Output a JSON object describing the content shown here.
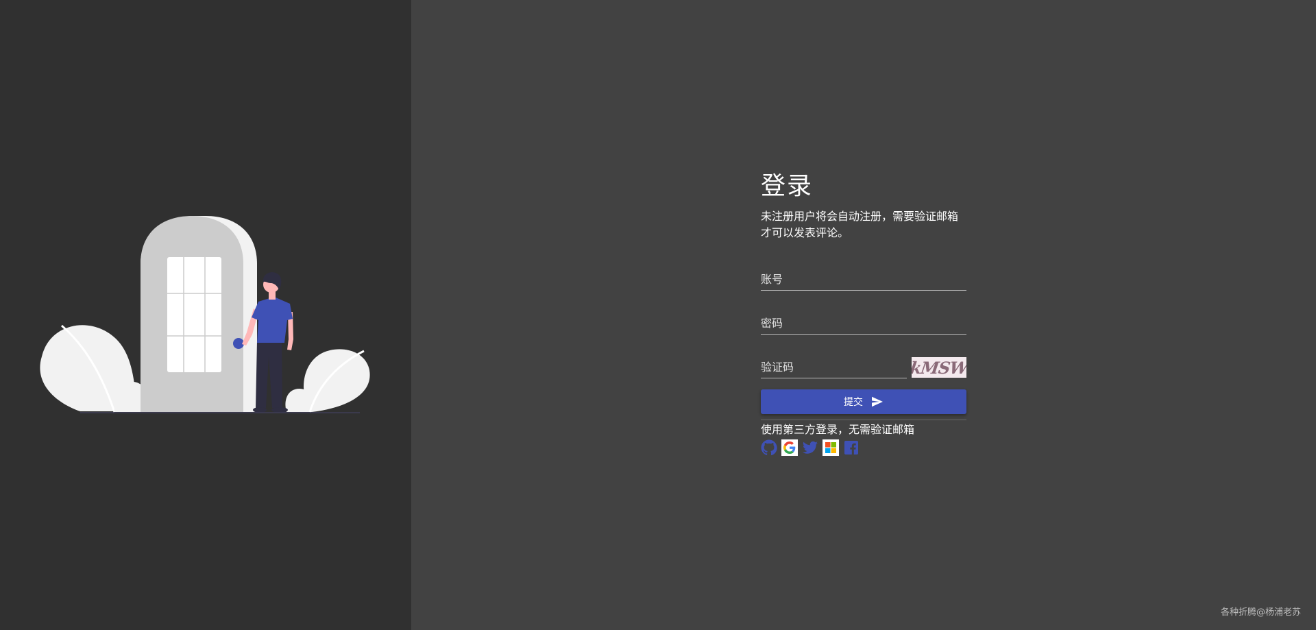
{
  "login": {
    "title": "登录",
    "subtitle": "未注册用户将会自动注册，需要验证邮箱才可以发表评论。",
    "account_placeholder": "账号",
    "password_placeholder": "密码",
    "captcha_placeholder": "验证码",
    "captcha_text": "kMSW",
    "submit_label": "提交",
    "third_party_text": "使用第三方登录，无需验证邮箱",
    "social_icons": [
      "github-icon",
      "google-icon",
      "twitter-icon",
      "microsoft-icon",
      "facebook-icon"
    ]
  },
  "footer": {
    "text": "各种折腾@杨浦老苏"
  },
  "colors": {
    "left_panel": "#303030",
    "right_panel": "#424242",
    "accent": "#3f51b5",
    "illustration_light": "#f2f2f2",
    "door": "#cccccc",
    "figure_shirt": "#3f51b5",
    "figure_skin": "#ffb8b8",
    "figure_pants": "#2f2e41"
  }
}
